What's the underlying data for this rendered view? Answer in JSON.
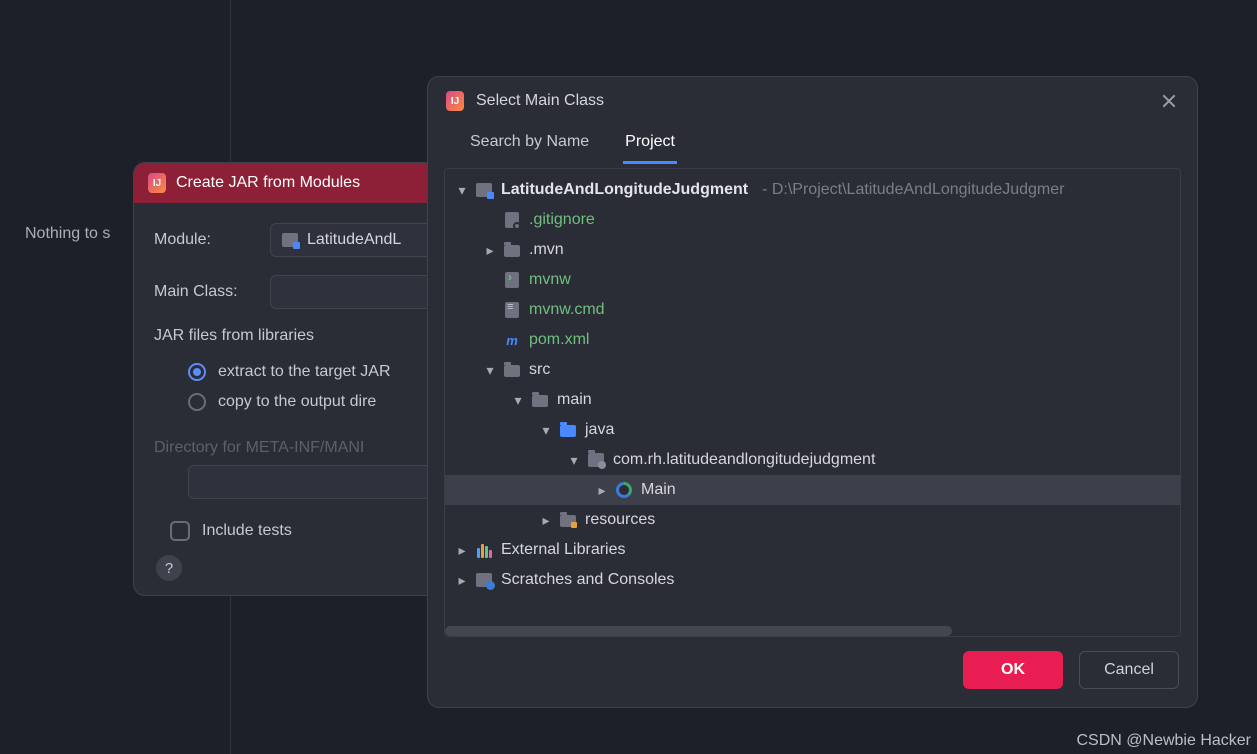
{
  "background": {
    "text": "Nothing to s"
  },
  "jar_dialog": {
    "title": "Create JAR from Modules",
    "module_label": "Module:",
    "module_value": "LatitudeAndL",
    "main_class_label": "Main Class:",
    "main_class_value": "",
    "libs_section_label": "JAR files from libraries",
    "radio_extract": "extract to the target JAR",
    "radio_copy": "copy to the output dire",
    "manifest_dir_label": "Directory for META-INF/MANI",
    "include_tests_label": "Include tests",
    "help_symbol": "?"
  },
  "select_dialog": {
    "title": "Select Main Class",
    "tab_search": "Search by Name",
    "tab_project": "Project",
    "ok_label": "OK",
    "cancel_label": "Cancel",
    "tree": {
      "project_name": "LatitudeAndLongitudeJudgment",
      "project_path": "- D:\\Project\\LatitudeAndLongitudeJudgmer",
      "gitignore": ".gitignore",
      "mvn": ".mvn",
      "mvnw": "mvnw",
      "mvnw_cmd": "mvnw.cmd",
      "pom": "pom.xml",
      "src": "src",
      "main_dir": "main",
      "java": "java",
      "package": "com.rh.latitudeandlongitudejudgment",
      "main_class": "Main",
      "resources": "resources",
      "ext_libs": "External Libraries",
      "scratches": "Scratches and Consoles"
    }
  },
  "watermark": "CSDN @Newbie Hacker"
}
